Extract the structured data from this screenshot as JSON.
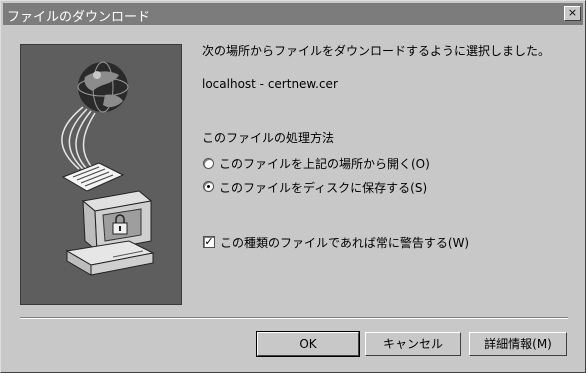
{
  "titlebar": {
    "title": "ファイルのダウンロード",
    "close_glyph": "×"
  },
  "message": "次の場所からファイルをダウンロードするように選択しました。",
  "file_source": "localhost - certnew.cer",
  "section_label": "このファイルの処理方法",
  "options": [
    {
      "label": "このファイルを上記の場所から開く(O)",
      "selected": false
    },
    {
      "label": "このファイルをディスクに保存する(S)",
      "selected": true
    }
  ],
  "warn_checkbox": {
    "label": "この種類のファイルであれば常に警告する(W)",
    "checked": true,
    "check_glyph": "✓"
  },
  "buttons": {
    "ok": "OK",
    "cancel": "キャンセル",
    "details": "詳細情報(M)"
  },
  "icons": [
    "globe-icon",
    "document-icon",
    "computer-icon",
    "lock-icon"
  ]
}
